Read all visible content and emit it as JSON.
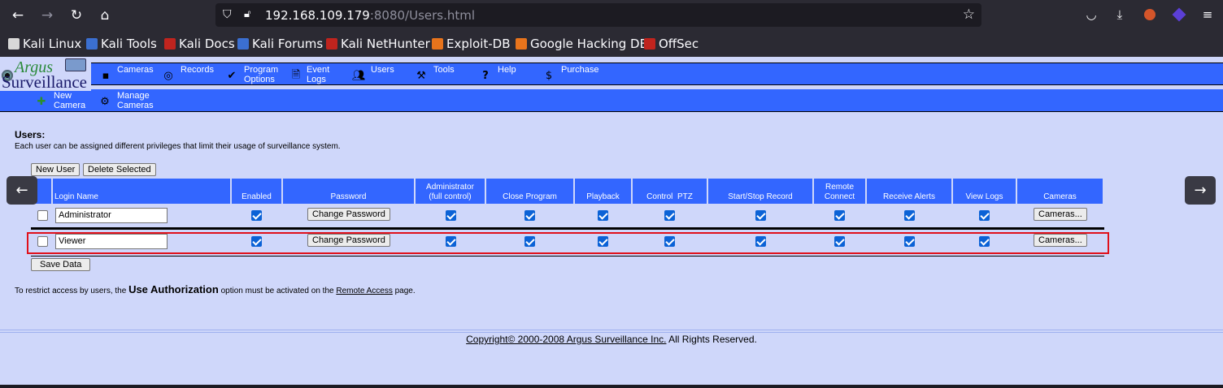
{
  "browser": {
    "url_host": "192.168.109.179",
    "url_rest": ":8080/Users.html",
    "nav": {
      "back": "←",
      "forward": "→",
      "reload": "↻",
      "home": "⌂"
    },
    "icons": {
      "shield": "shield-icon",
      "lock": "lock-icon",
      "star": "bookmark-star-icon"
    },
    "right_icons": [
      "pocket-icon",
      "download-icon",
      "extension-icon",
      "extension-icon",
      "menu-icon"
    ]
  },
  "bookmarks": [
    {
      "label": "Kali Linux",
      "color": "#d8d8d8"
    },
    {
      "label": "Kali Tools",
      "color": "#3b6fd1"
    },
    {
      "label": "Kali Docs",
      "color": "#c0241e"
    },
    {
      "label": "Kali Forums",
      "color": "#3b6fd1"
    },
    {
      "label": "Kali NetHunter",
      "color": "#c0241e"
    },
    {
      "label": "Exploit-DB",
      "color": "#e8741c"
    },
    {
      "label": "Google Hacking DB",
      "color": "#e8741c"
    },
    {
      "label": "OffSec",
      "color": "#c0241e"
    }
  ],
  "app": {
    "logo_line1": "Argus",
    "logo_line2": "Surveillance",
    "menu": [
      {
        "line1": "Cameras",
        "line2": "",
        "icon": "camera-icon"
      },
      {
        "line1": "Records",
        "line2": "",
        "icon": "disc-icon"
      },
      {
        "line1": "Program",
        "line2": "Options",
        "icon": "checkmark-icon"
      },
      {
        "line1": "Event",
        "line2": "Logs",
        "icon": "document-icon"
      },
      {
        "line1": "Users",
        "line2": "",
        "icon": "users-icon"
      },
      {
        "line1": "Tools",
        "line2": "",
        "icon": "tools-icon"
      },
      {
        "line1": "Help",
        "line2": "",
        "icon": "help-icon"
      },
      {
        "line1": "Purchase",
        "line2": "",
        "icon": "dollar-icon"
      }
    ],
    "submenu": [
      {
        "line1": "New",
        "line2": "Camera",
        "icon": "new-camera-icon"
      },
      {
        "line1": "Manage",
        "line2": "Cameras",
        "icon": "manage-cameras-icon"
      }
    ]
  },
  "users_page": {
    "title": "Users:",
    "description": "Each user can be assigned different privileges that limit their usage of surveillance system.",
    "new_user": "New User",
    "delete_selected": "Delete Selected",
    "save_data": "Save Data",
    "columns": [
      "",
      "Login Name",
      "Enabled",
      "Password",
      "Administrator\n(full control)",
      "Close Program",
      "Playback",
      "Control  PTZ",
      "Start/Stop Record",
      "Remote\nConnect",
      "Receive Alerts",
      "View Logs",
      "Cameras"
    ],
    "rows": [
      {
        "login": "Administrator",
        "change_password": "Change Password",
        "cameras": "Cameras..."
      },
      {
        "login": "Viewer",
        "change_password": "Change Password",
        "cameras": "Cameras..."
      }
    ],
    "note_before": "To restrict access by users, the",
    "note_bold": "Use Authorization",
    "note_mid": "option must be activated on the",
    "note_link": "Remote Access",
    "note_after": "page.",
    "footer_link": "Copyright© 2000-2008 Argus Surveillance Inc.",
    "footer_rest": "All Rights Reserved."
  },
  "side_arrows": {
    "left": "←",
    "right": "→"
  }
}
